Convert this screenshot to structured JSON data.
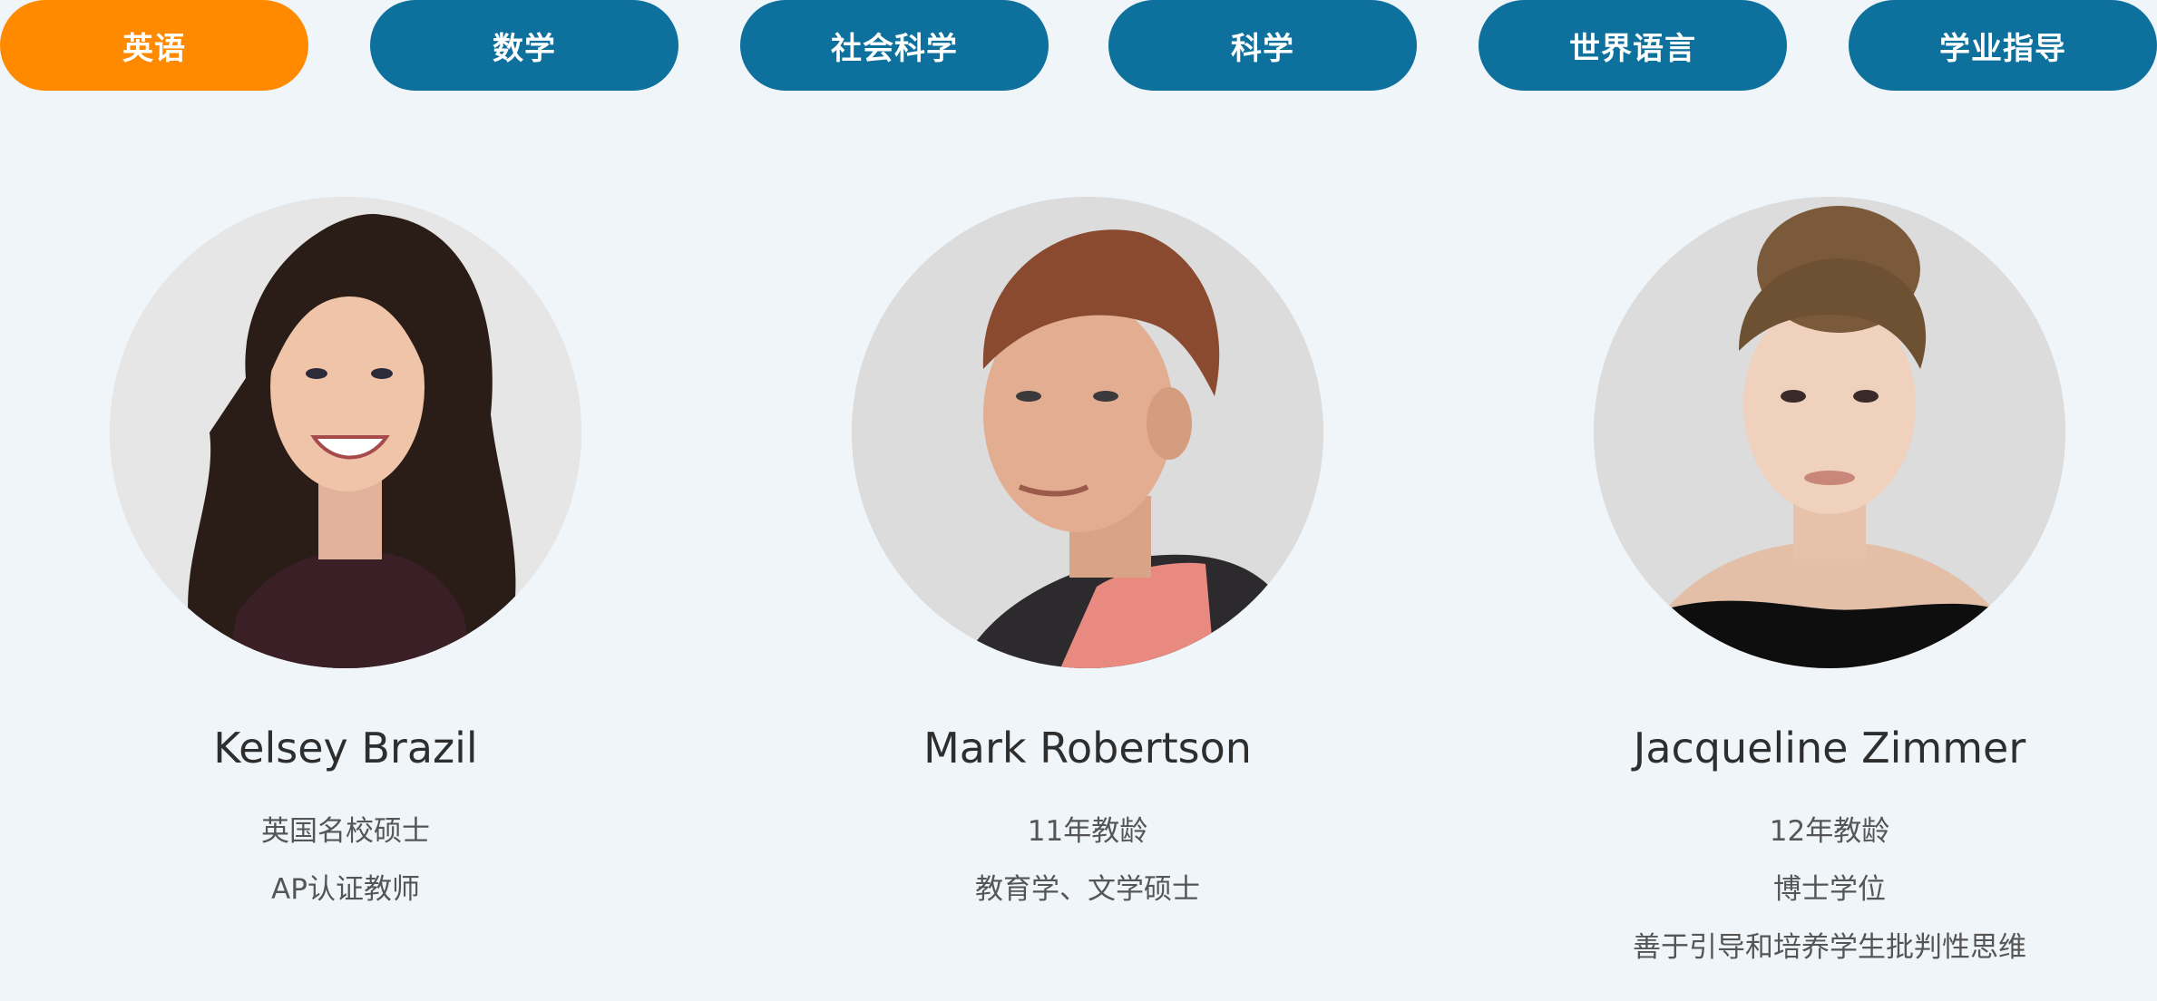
{
  "tabs": [
    {
      "label": "英语",
      "active": true
    },
    {
      "label": "数学",
      "active": false
    },
    {
      "label": "社会科学",
      "active": false
    },
    {
      "label": "科学",
      "active": false
    },
    {
      "label": "世界语言",
      "active": false
    },
    {
      "label": "学业指导",
      "active": false
    }
  ],
  "colors": {
    "active_tab": "#ff8a00",
    "inactive_tab": "#0e709c",
    "background": "#f0f5fa",
    "photo_bg": "#d9d9d9"
  },
  "teachers": [
    {
      "name": "Kelsey Brazil",
      "details": [
        "英国名校硕士",
        "AP认证教师"
      ],
      "photo_icon": "teacher-portrait-female-long-hair"
    },
    {
      "name": "Mark Robertson",
      "details": [
        "11年教龄",
        "教育学、文学硕士"
      ],
      "photo_icon": "teacher-portrait-male"
    },
    {
      "name": "Jacqueline Zimmer",
      "details": [
        "12年教龄",
        "博士学位",
        "善于引导和培养学生批判性思维"
      ],
      "photo_icon": "teacher-portrait-female-bun"
    }
  ]
}
